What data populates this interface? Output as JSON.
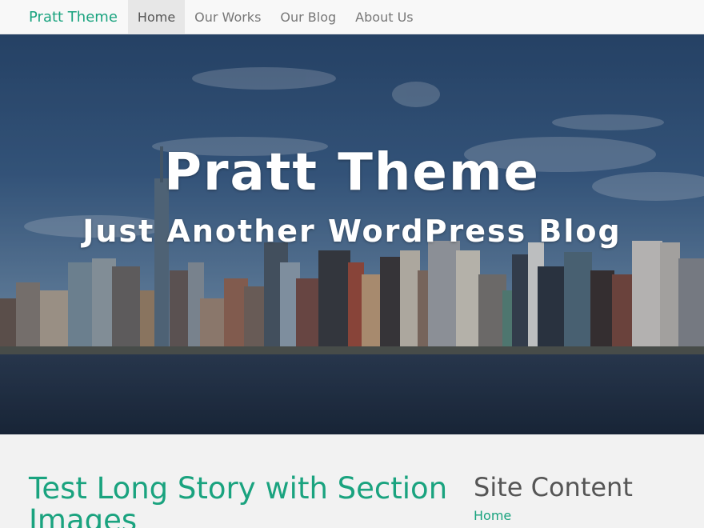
{
  "navbar": {
    "brand": "Pratt Theme",
    "items": [
      {
        "label": "Home",
        "active": true
      },
      {
        "label": "Our Works",
        "active": false
      },
      {
        "label": "Our Blog",
        "active": false
      },
      {
        "label": "About Us",
        "active": false
      }
    ]
  },
  "hero": {
    "title": "Pratt Theme",
    "subtitle": "Just Another WordPress Blog"
  },
  "main": {
    "post_title": "Test Long Story with Section Images"
  },
  "sidebar": {
    "title": "Site Content",
    "links": [
      "Home"
    ]
  },
  "colors": {
    "accent": "#1aa37f",
    "nav_bg": "#f8f8f8",
    "page_bg": "#f2f2f2"
  }
}
